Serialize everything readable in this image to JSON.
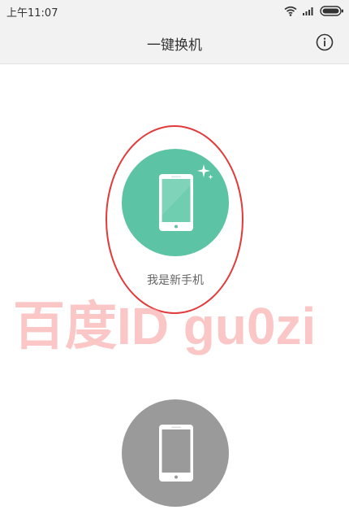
{
  "status_bar": {
    "time": "上午11:07",
    "icons": [
      "wifi-icon",
      "signal-icon",
      "battery-icon"
    ]
  },
  "header": {
    "title": "一键换机",
    "info_icon": "info-icon"
  },
  "options": [
    {
      "label": "我是新手机",
      "icon": "phone-icon",
      "sparkle_icon": "sparkle-icon",
      "color": "#5cc4a4"
    },
    {
      "label": "",
      "icon": "phone-icon",
      "color": "#9a9a9a"
    }
  ],
  "annotation": {
    "highlight_color": "#e23a3a"
  },
  "watermark": {
    "text": "百度ID gu0zi"
  }
}
